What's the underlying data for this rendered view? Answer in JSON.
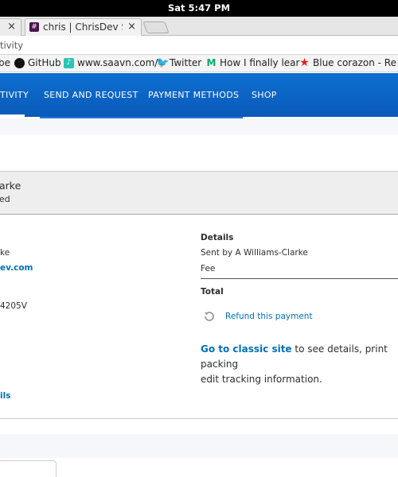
{
  "os": {
    "clock": "Sat  5:47 PM"
  },
  "tabs": [
    {
      "title": "",
      "close": "×"
    },
    {
      "favicon": "#",
      "title": "chris | ChrisDev Sla",
      "close": "×"
    }
  ],
  "address_bar": {
    "text": "tivity"
  },
  "bookmarks": [
    {
      "label": "be",
      "icon": ""
    },
    {
      "label": "GitHub",
      "icon": "github-icon"
    },
    {
      "label": "www.saavn.com/",
      "icon": "saavn-icon"
    },
    {
      "label": "Twitter",
      "icon": "twitter-icon"
    },
    {
      "label": "How I finally lear",
      "icon": "medium-icon"
    },
    {
      "label": "Blue corazon - Re",
      "icon": "star-icon"
    }
  ],
  "nav": {
    "items": [
      "TIVITY",
      "SEND AND REQUEST",
      "PAYMENT METHODS",
      "SHOP"
    ]
  },
  "transaction": {
    "name": "arke",
    "status": "ed",
    "left_col": {
      "line1": "ke",
      "email": "ev.com",
      "id": "4205V",
      "details_link": "ils"
    },
    "details": {
      "heading": "Details",
      "sent_by": "Sent by A Williams-Clarke",
      "fee": "Fee",
      "total": "Total",
      "refund": "Refund this payment",
      "classic_link": "Go to classic site",
      "classic_rest": " to see details, print packing",
      "classic_line2": "edit tracking information."
    }
  },
  "colors": {
    "nav_blue": "#0b61c7",
    "link_blue": "#0070ba"
  }
}
